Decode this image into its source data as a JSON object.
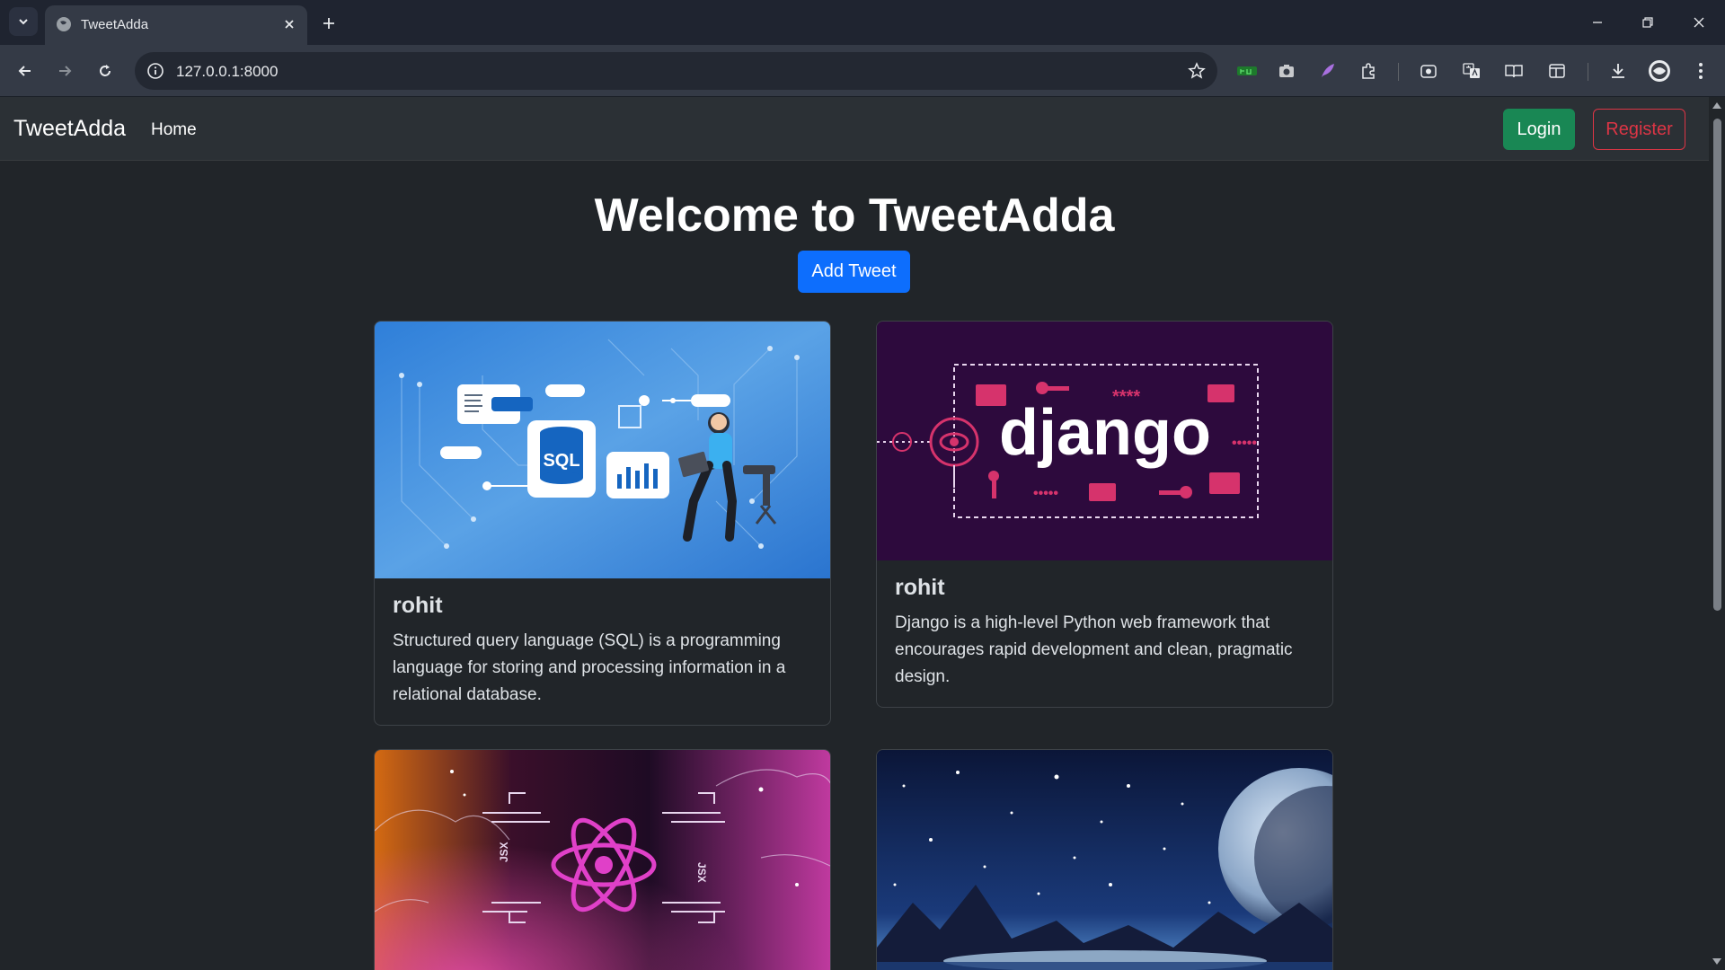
{
  "browser": {
    "tab_title": "TweetAdda",
    "url": "127.0.0.1:8000"
  },
  "navbar": {
    "brand": "TweetAdda",
    "home": "Home",
    "login": "Login",
    "register": "Register"
  },
  "hero": {
    "title": "Welcome to TweetAdda",
    "add_tweet": "Add Tweet"
  },
  "tweets": [
    {
      "author": "rohit",
      "text": "Structured query language (SQL) is a programming language for storing and processing information in a relational database.",
      "image_label": "SQL"
    },
    {
      "author": "rohit",
      "text": "Django is a high-level Python web framework that encourages rapid development and clean, pragmatic design.",
      "image_label": "django"
    },
    {
      "image_label": "JSX"
    },
    {
      "image_label": ""
    }
  ],
  "colors": {
    "success": "#198754",
    "danger": "#dc3545",
    "primary": "#0d6efd",
    "django_bg": "#2d0a3d"
  }
}
